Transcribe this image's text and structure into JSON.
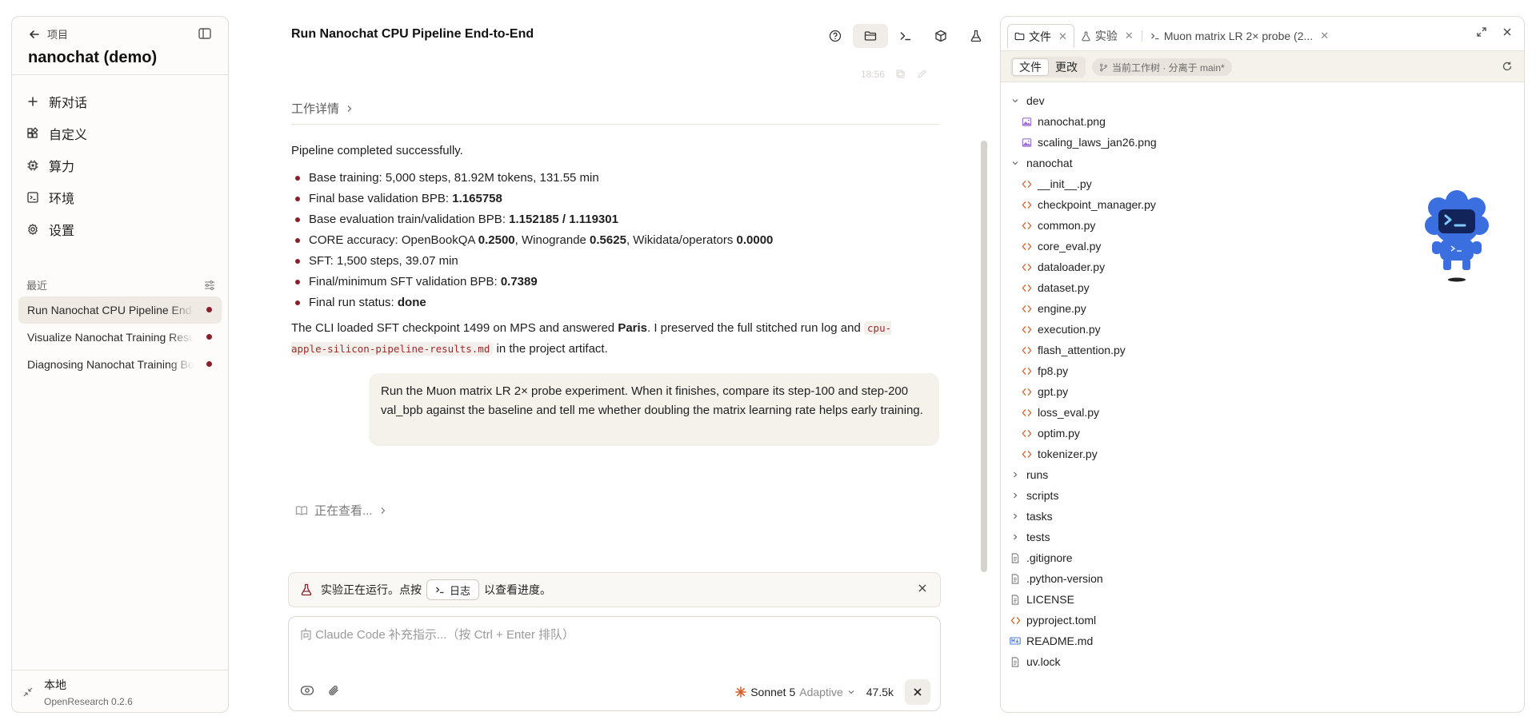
{
  "sidebar": {
    "back_label": "项目",
    "project_title": "nanochat (demo)",
    "nav": [
      {
        "label": "新对话",
        "icon": "plus-icon"
      },
      {
        "label": "自定义",
        "icon": "widgets-icon"
      },
      {
        "label": "算力",
        "icon": "chip-icon"
      },
      {
        "label": "环境",
        "icon": "environment-icon"
      },
      {
        "label": "设置",
        "icon": "gear-icon"
      }
    ],
    "recent_label": "最近",
    "recent": [
      {
        "label": "Run Nanochat CPU Pipeline End-to-End",
        "active": true
      },
      {
        "label": "Visualize Nanochat Training Results",
        "active": false
      },
      {
        "label": "Diagnosing Nanochat Training Bottlenecks",
        "active": false
      }
    ],
    "footer": {
      "title": "本地",
      "subtitle": "OpenResearch 0.2.6"
    }
  },
  "chat": {
    "title": "Run Nanochat CPU Pipeline End-to-End",
    "faded_time": "18:56",
    "work_detail": "工作详情",
    "intro": "Pipeline completed successfully.",
    "bullets": [
      {
        "pre": "Base training: 5,000 steps, 81.92M tokens, 131.55 min"
      },
      {
        "pre": "Final base validation BPB: ",
        "b1": "1.165758"
      },
      {
        "pre": "Base evaluation train/validation BPB: ",
        "b1": "1.152185 / 1.119301"
      },
      {
        "pre": "CORE accuracy: OpenBookQA ",
        "b1": "0.2500",
        "m1": ", Winogrande ",
        "b2": "0.5625",
        "m2": ", Wikidata/operators ",
        "b3": "0.0000"
      },
      {
        "pre": "SFT: 1,500 steps, 39.07 min"
      },
      {
        "pre": "Final/minimum SFT validation BPB: ",
        "b1": "0.7389"
      },
      {
        "pre": "Final run status: ",
        "b1": "done"
      }
    ],
    "outro": {
      "p1": "The CLI loaded SFT checkpoint 1499 on MPS and answered ",
      "bold": "Paris",
      "p2": ". I preserved the full stitched run log and ",
      "code": "cpu-apple-silicon-pipeline-results.md",
      "p3": " in the project artifact."
    },
    "user_message": "Run the Muon matrix LR 2× probe experiment. When it finishes, compare its step-100 and step-200 val_bpb against the baseline and tell me whether doubling the matrix learning rate helps early training.",
    "viewing": "正在查看...",
    "banner": {
      "pre": "实验正在运行。点按",
      "button": "日志",
      "post": "以查看进度。"
    },
    "composer": {
      "placeholder": "向 Claude Code 补充指示...（按 Ctrl + Enter 排队）",
      "model": "Sonnet 5",
      "mode": "Adaptive",
      "tokens": "47.5k"
    }
  },
  "right_panel": {
    "tabs": [
      {
        "label": "文件",
        "icon": "folder-icon",
        "active": true
      },
      {
        "label": "实验",
        "icon": "flask-icon",
        "active": false
      },
      {
        "label": "Muon matrix LR 2× probe (2...",
        "icon": "terminal-icon",
        "active": false
      }
    ],
    "segments": [
      "文件",
      "更改"
    ],
    "branch": "当前工作树 · 分离于 main*",
    "tree": [
      {
        "name": "dev",
        "type": "folder-open",
        "depth": 1
      },
      {
        "name": "nanochat.png",
        "type": "image",
        "depth": 2
      },
      {
        "name": "scaling_laws_jan26.png",
        "type": "image",
        "depth": 2
      },
      {
        "name": "nanochat",
        "type": "folder-open",
        "depth": 1
      },
      {
        "name": "__init__.py",
        "type": "code",
        "depth": 2
      },
      {
        "name": "checkpoint_manager.py",
        "type": "code",
        "depth": 2
      },
      {
        "name": "common.py",
        "type": "code",
        "depth": 2
      },
      {
        "name": "core_eval.py",
        "type": "code",
        "depth": 2
      },
      {
        "name": "dataloader.py",
        "type": "code",
        "depth": 2
      },
      {
        "name": "dataset.py",
        "type": "code",
        "depth": 2
      },
      {
        "name": "engine.py",
        "type": "code",
        "depth": 2
      },
      {
        "name": "execution.py",
        "type": "code",
        "depth": 2
      },
      {
        "name": "flash_attention.py",
        "type": "code",
        "depth": 2
      },
      {
        "name": "fp8.py",
        "type": "code",
        "depth": 2
      },
      {
        "name": "gpt.py",
        "type": "code",
        "depth": 2
      },
      {
        "name": "loss_eval.py",
        "type": "code",
        "depth": 2
      },
      {
        "name": "optim.py",
        "type": "code",
        "depth": 2
      },
      {
        "name": "tokenizer.py",
        "type": "code",
        "depth": 2
      },
      {
        "name": "runs",
        "type": "folder-closed",
        "depth": 1
      },
      {
        "name": "scripts",
        "type": "folder-closed",
        "depth": 1
      },
      {
        "name": "tasks",
        "type": "folder-closed",
        "depth": 1
      },
      {
        "name": "tests",
        "type": "folder-closed",
        "depth": 1
      },
      {
        "name": ".gitignore",
        "type": "file",
        "depth": 1
      },
      {
        "name": ".python-version",
        "type": "file",
        "depth": 1
      },
      {
        "name": "LICENSE",
        "type": "file",
        "depth": 1
      },
      {
        "name": "pyproject.toml",
        "type": "code",
        "depth": 1
      },
      {
        "name": "README.md",
        "type": "markdown",
        "depth": 1
      },
      {
        "name": "uv.lock",
        "type": "file",
        "depth": 1
      }
    ]
  },
  "colors": {
    "accent": "#8a1f2a",
    "code_icon": "#d4622a",
    "image_icon": "#9b6dd1",
    "markdown_icon": "#4a7bd6",
    "mascot": "#3b6fe0"
  }
}
